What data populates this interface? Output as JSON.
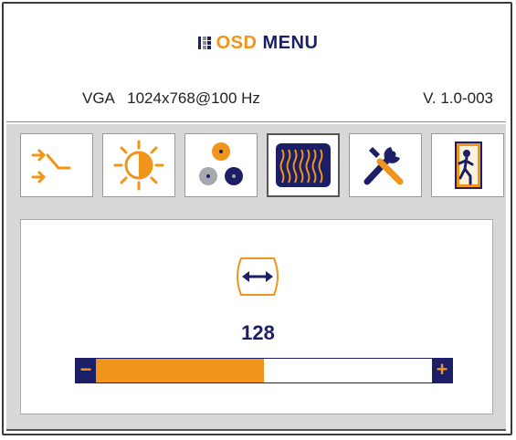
{
  "header": {
    "osd_word": "OSD",
    "menu_word": "MENU",
    "signal_info": "VGA   1024x768@100 Hz",
    "version": "V. 1.0-003"
  },
  "tabs": [
    {
      "name": "input-select",
      "icon": "input-arrows-icon",
      "active": false
    },
    {
      "name": "brightness",
      "icon": "sun-icon",
      "active": false
    },
    {
      "name": "color",
      "icon": "color-dots-icon",
      "active": false
    },
    {
      "name": "image",
      "icon": "wave-pattern-icon",
      "active": true
    },
    {
      "name": "tools",
      "icon": "wrench-screwdriver-icon",
      "active": false
    },
    {
      "name": "exit",
      "icon": "exit-door-icon",
      "active": false
    }
  ],
  "adjustment": {
    "icon": "horizontal-position-icon",
    "value": "128",
    "minus_label": "−",
    "plus_label": "+",
    "level_fraction": 0.5
  },
  "colors": {
    "accent": "#f0941a",
    "navy": "#1c1f66"
  }
}
